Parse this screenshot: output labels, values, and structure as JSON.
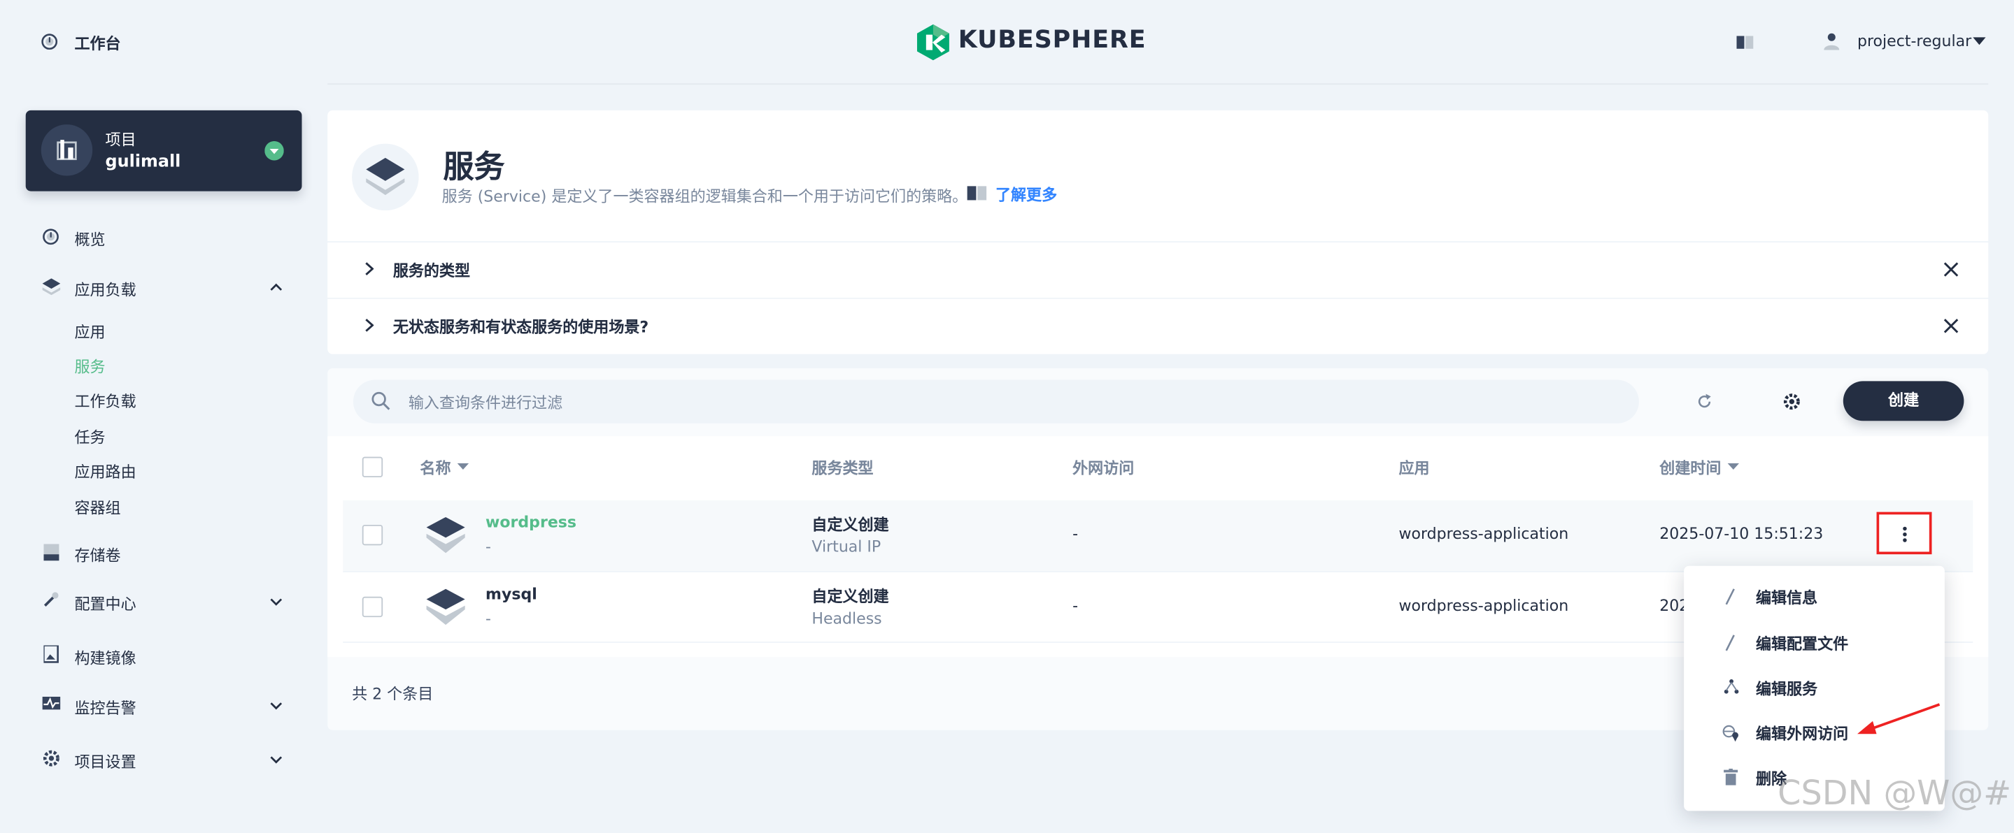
{
  "header": {
    "workbench_label": "工作台",
    "brand": "KUBESPHERE",
    "username": "project-regular"
  },
  "project": {
    "type_label": "项目",
    "name": "gulimall"
  },
  "sidebar": {
    "overview": "概览",
    "workloads_group": "应用负载",
    "workloads_items": [
      "应用",
      "服务",
      "工作负载",
      "任务",
      "应用路由",
      "容器组"
    ],
    "active_item": "服务",
    "storage": "存储卷",
    "config": "配置中心",
    "build_image": "构建镜像",
    "monitoring": "监控告警",
    "settings": "项目设置"
  },
  "banner": {
    "title": "服务",
    "description": "服务 (Service) 是定义了一类容器组的逻辑集合和一个用于访问它们的策略。",
    "learn_more": "了解更多"
  },
  "tips": [
    "服务的类型",
    "无状态服务和有状态服务的使用场景?"
  ],
  "toolbar": {
    "search_placeholder": "输入查询条件进行过滤",
    "create_label": "创建"
  },
  "table": {
    "headers": [
      "名称",
      "服务类型",
      "外网访问",
      "应用",
      "创建时间"
    ],
    "rows": [
      {
        "name": "wordpress",
        "name_sub": "-",
        "type": "自定义创建",
        "type_sub": "Virtual IP",
        "external": "-",
        "app": "wordpress-application",
        "created": "2025-07-10 15:51:23"
      },
      {
        "name": "mysql",
        "name_sub": "-",
        "type": "自定义创建",
        "type_sub": "Headless",
        "external": "-",
        "app": "wordpress-application",
        "created": "202"
      }
    ],
    "footer": "共 2 个条目"
  },
  "context_menu": {
    "items": [
      "编辑信息",
      "编辑配置文件",
      "编辑服务",
      "编辑外网访问",
      "删除"
    ]
  },
  "watermark": "CSDN @W@#",
  "colors": {
    "accent_green": "#55bc8a",
    "dark": "#242e42",
    "muted": "#79879c",
    "highlight_red": "#ee2222"
  }
}
